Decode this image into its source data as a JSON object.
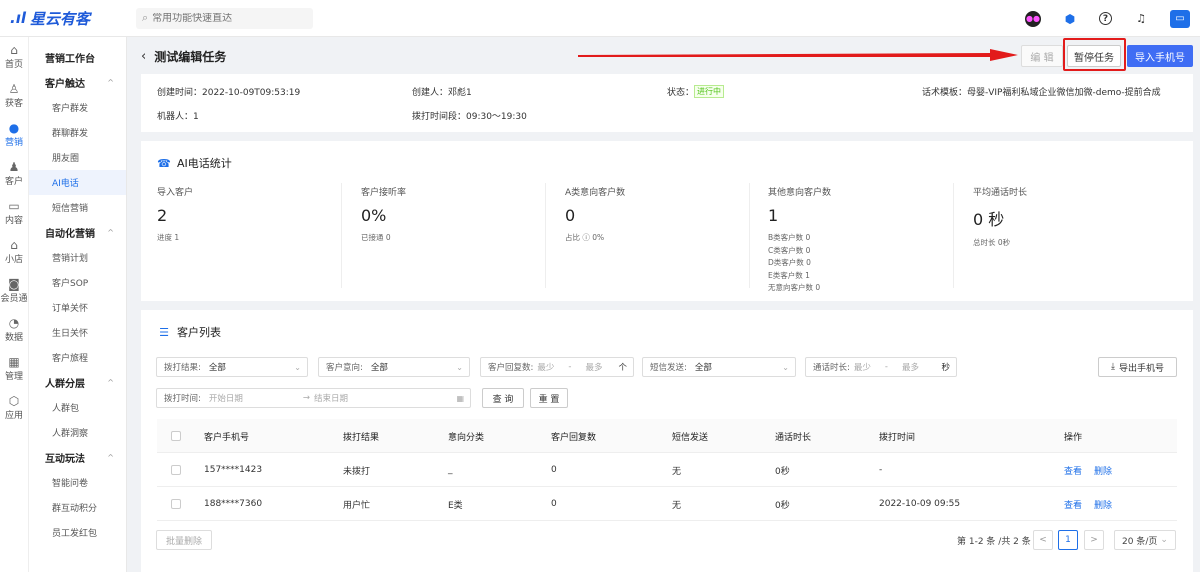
{
  "brand": {
    "mark": ".ıl",
    "name": "星云有客"
  },
  "search": {
    "placeholder": "常用功能快速直达"
  },
  "top_icons": [
    "robot-icon",
    "cube-icon",
    "help-icon",
    "headset-icon",
    "app-icon"
  ],
  "rail": [
    {
      "icon": "home-icon",
      "label": "首页"
    },
    {
      "icon": "user-icon",
      "label": "获客"
    },
    {
      "icon": "bulb-icon",
      "label": "营销",
      "active": true
    },
    {
      "icon": "person-icon",
      "label": "客户"
    },
    {
      "icon": "folder-icon",
      "label": "内容"
    },
    {
      "icon": "shop-icon",
      "label": "小店"
    },
    {
      "icon": "member-icon",
      "label": "会员通"
    },
    {
      "icon": "chart-icon",
      "label": "数据"
    },
    {
      "icon": "grid-icon",
      "label": "管理"
    },
    {
      "icon": "apps-icon",
      "label": "应用"
    }
  ],
  "subnav": {
    "workbench": "营销工作台",
    "groups": [
      {
        "title": "客户触达",
        "items": [
          "客户群发",
          "群聊群发",
          "朋友圈",
          "AI电话",
          "短信营销"
        ]
      },
      {
        "title": "自动化营销",
        "items": [
          "营销计划",
          "客户SOP",
          "订单关怀",
          "生日关怀",
          "客户旅程"
        ]
      },
      {
        "title": "人群分层",
        "items": [
          "人群包",
          "人群洞察"
        ]
      },
      {
        "title": "互动玩法",
        "items": [
          "智能问卷",
          "群互动积分",
          "员工发红包"
        ]
      }
    ]
  },
  "header": {
    "title": "测试编辑任务",
    "edit_label": "编 辑",
    "pause_label": "暂停任务",
    "import_label": "导入手机号"
  },
  "info": {
    "created_time": "创建时间：2022-10-09T09:53:19",
    "creator": "创建人：邓彪1",
    "status_label": "状态：",
    "status_value": "进行中",
    "template": "话术模板：母婴-VIP福利私域企业微信加微-demo-提前合成",
    "robot": "机器人：1",
    "call_period": "拨打时间段：09:30～19:30"
  },
  "stats": {
    "title": "AI电话统计",
    "items": [
      {
        "label": "导入客户",
        "value": "2",
        "sub": [
          "进度  1"
        ]
      },
      {
        "label": "客户接听率",
        "value": "0%",
        "sub": [
          "已接通  0"
        ]
      },
      {
        "label": "A类意向客户数",
        "value": "0",
        "sub": [
          "占比 ⓘ  0%"
        ]
      },
      {
        "label": "其他意向客户数",
        "value": "1",
        "sub": [
          "B类客户数   0",
          "C类客户数   0",
          "D类客户数   0",
          "E类客户数   1",
          "无意向客户数   0"
        ]
      },
      {
        "label": "平均通话时长",
        "value": "0 秒",
        "sub": [
          "总时长  0秒"
        ]
      }
    ]
  },
  "list": {
    "title": "客户列表",
    "filters": {
      "dial_result": {
        "label": "拨打结果:",
        "value": "全部"
      },
      "intent": {
        "label": "客户意向:",
        "value": "全部"
      },
      "reply_count": {
        "label": "客户回复数:",
        "min": "最少",
        "sep": "-",
        "max": "最多",
        "unit": "个"
      },
      "sms": {
        "label": "短信发送:",
        "value": "全部"
      },
      "call_duration": {
        "label": "通话时长:",
        "min": "最少",
        "sep": "-",
        "max": "最多",
        "unit": "秒"
      },
      "dial_time": {
        "label": "拨打时间:",
        "start": "开始日期",
        "arrow": "→",
        "end": "结束日期"
      }
    },
    "export_label": "导出手机号",
    "query_label": "查 询",
    "reset_label": "重 置",
    "columns": [
      "客户手机号",
      "拨打结果",
      "意向分类",
      "客户回复数",
      "短信发送",
      "通话时长",
      "拨打时间",
      "操作"
    ],
    "rows": [
      {
        "phone": "157****1423",
        "result": "未拨打",
        "intent": "_",
        "replies": "0",
        "sms": "无",
        "duration": "0秒",
        "time": "-"
      },
      {
        "phone": "188****7360",
        "result": "用户忙",
        "intent": "E类",
        "replies": "0",
        "sms": "无",
        "duration": "0秒",
        "time": "2022-10-09 09:55"
      }
    ],
    "actions": {
      "view": "查看",
      "delete": "删除"
    },
    "batch_delete": "批量删除",
    "pager": {
      "summary": "第 1-2 条 /共 2 条",
      "prev": "<",
      "current": "1",
      "next": ">",
      "page_size": "20 条/页"
    }
  },
  "colors": {
    "accent": "#3f6df4",
    "annotation": "#e21b1b",
    "status_green": "#52c41a"
  }
}
